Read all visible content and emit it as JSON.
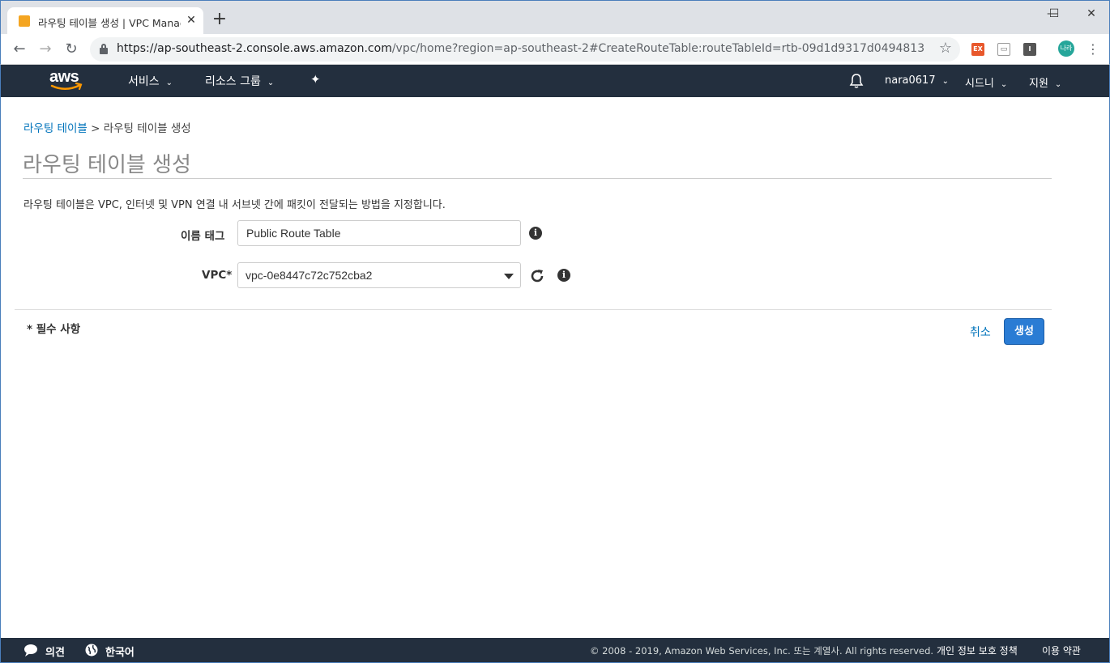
{
  "browser": {
    "tab_title": "라우팅 테이블 생성 | VPC Manag",
    "tab_close": "✕",
    "new_tab": "+",
    "minimize": "—",
    "maximize": "☐",
    "close": "✕",
    "url_host": "https://ap-southeast-2.console.aws.amazon.com",
    "url_rest": "/vpc/home?region=ap-southeast-2#CreateRouteTable:routeTableId=rtb-09d1d9317d0494813",
    "back": "←",
    "forward": "→",
    "reload": "↻",
    "star": "☆",
    "extensions": [
      "EX",
      "▭",
      "I"
    ],
    "profile_label": "나라",
    "menu": "⋮"
  },
  "aws_nav": {
    "logo": "aws",
    "services": "서비스",
    "resource_groups": "리소스 그룹",
    "pin": "✦",
    "user": "nara0617",
    "region": "시드니",
    "support": "지원",
    "caret": "⌄"
  },
  "breadcrumb": {
    "parent": "라우팅 테이블",
    "separator": " > ",
    "current": "라우팅 테이블 생성"
  },
  "page": {
    "title": "라우팅 테이블 생성",
    "description": "라우팅 테이블은 VPC, 인터넷 및 VPN 연결 내 서브넷 간에 패킷이 전달되는 방법을 지정합니다."
  },
  "form": {
    "name_tag_label": "이름 태그",
    "name_tag_value": "Public Route Table",
    "vpc_label": "VPC*",
    "vpc_value": "vpc-0e8447c72c752cba2",
    "info": "i",
    "required_note": "* 필수 사항",
    "cancel": "취소",
    "create": "생성"
  },
  "footer": {
    "feedback": "의견",
    "language": "한국어",
    "copyright": "© 2008 - 2019, Amazon Web Services, Inc. 또는 계열사. All rights reserved.",
    "privacy": "개인 정보 보호 정책",
    "terms": "이용 약관"
  }
}
